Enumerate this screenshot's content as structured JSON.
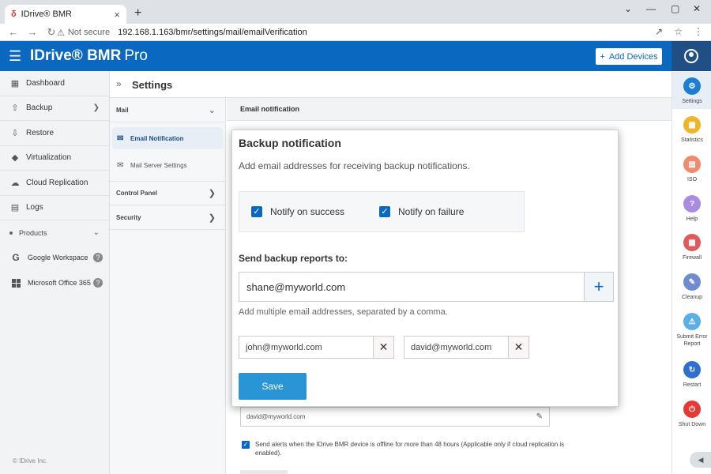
{
  "browser": {
    "tab_title": "IDrive® BMR",
    "tab_favicon": "δ",
    "close_tab": "×",
    "new_tab": "+",
    "minimize": "⌄",
    "min_btn": "—",
    "max_btn": "▢",
    "close_btn": "✕",
    "security": "Not secure",
    "url": "192.168.1.163/bmr/settings/mail/emailVerification"
  },
  "header": {
    "brand": "IDrive® BMR",
    "product": "Pro",
    "add_devices": "Add Devices",
    "color": "#0b68c1"
  },
  "leftnav": {
    "items": [
      {
        "label": "Dashboard",
        "icon": "dashboard-icon"
      },
      {
        "label": "Backup",
        "icon": "backup-icon"
      },
      {
        "label": "Restore",
        "icon": "restore-icon"
      },
      {
        "label": "Virtualization",
        "icon": "virtualization-icon"
      },
      {
        "label": "Cloud Replication",
        "icon": "cloud-icon"
      },
      {
        "label": "Logs",
        "icon": "logs-icon"
      }
    ],
    "products_label": "Products",
    "products": [
      {
        "label": "Google Workspace",
        "icon": "google-icon"
      },
      {
        "label": "Microsoft Office 365",
        "icon": "microsoft-icon"
      }
    ],
    "copyright": "© IDrive Inc."
  },
  "settings": {
    "title": "Settings",
    "sections": {
      "mail": "Mail",
      "control_panel": "Control Panel",
      "security": "Security"
    },
    "mail_items": {
      "email_notification": "Email Notification",
      "mail_server_settings": "Mail Server Settings"
    },
    "content_title": "Email notification",
    "bg_email": "david@myworld.com",
    "offline_alert": "Send alerts when the IDrive BMR device is offline for more than 48 hours (Applicable only if cloud replication is enabled)."
  },
  "rightpanel": {
    "items": [
      {
        "label": "Settings",
        "icon": "gear-icon",
        "color": "#1a7fd4"
      },
      {
        "label": "Statistics",
        "icon": "bar-chart-icon",
        "color": "#f0b429"
      },
      {
        "label": "ISO",
        "icon": "iso-file-icon",
        "color": "#f08a6c"
      },
      {
        "label": "Help",
        "icon": "help-icon",
        "color": "#a98ce0"
      },
      {
        "label": "Firewall",
        "icon": "firewall-icon",
        "color": "#e0595c"
      },
      {
        "label": "Cleanup",
        "icon": "cleanup-icon",
        "color": "#6f8ccf"
      },
      {
        "label": "Submit Error Report",
        "icon": "warning-icon",
        "color": "#5ab0e6"
      },
      {
        "label": "Restart",
        "icon": "restart-icon",
        "color": "#2f6fd0"
      },
      {
        "label": "Shut Down",
        "icon": "power-icon",
        "color": "#e53935"
      }
    ]
  },
  "modal": {
    "title": "Backup notification",
    "description": "Add email addresses for receiving backup notifications.",
    "notify_success": "Notify on success",
    "notify_failure": "Notify on failure",
    "send_label": "Send backup reports to:",
    "email_value": "shane@myworld.com",
    "hint": "Add multiple email addresses, separated by a comma.",
    "chips": [
      "john@myworld.com",
      "david@myworld.com"
    ],
    "save": "Save",
    "accent": "#2a95d4"
  }
}
